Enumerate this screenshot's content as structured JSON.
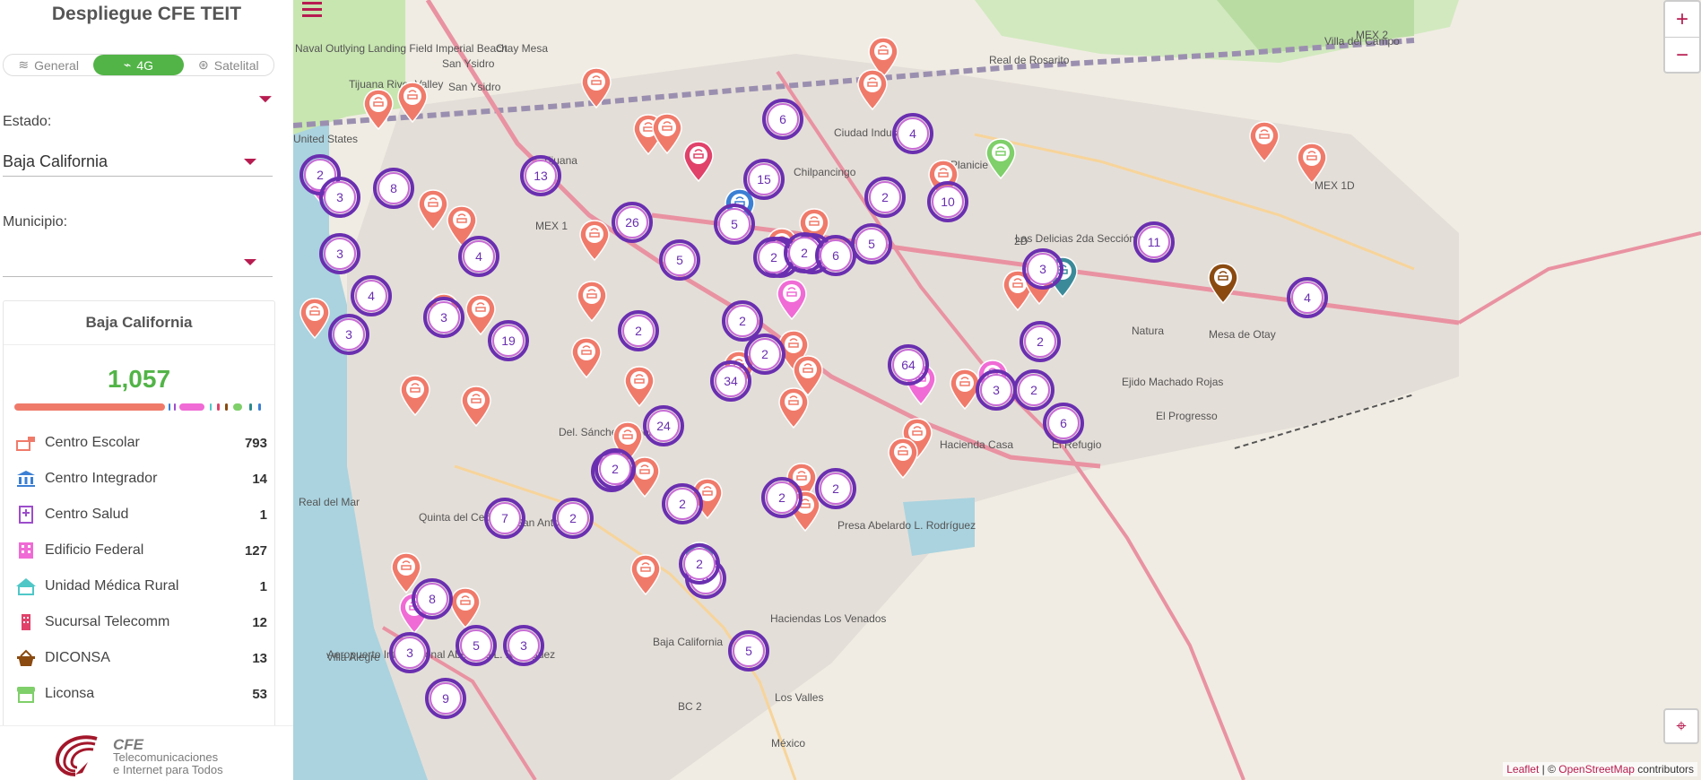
{
  "app": {
    "title": "Despliegue CFE TEIT"
  },
  "network_toggle": {
    "options": [
      {
        "label": "General",
        "icon": "layers-icon"
      },
      {
        "label": "4G",
        "icon": "wifi-router-icon"
      },
      {
        "label": "Satelital",
        "icon": "satellite-icon"
      }
    ],
    "selected": "4G"
  },
  "filters": {
    "clear_icon": "filter-clear-icon",
    "estado": {
      "label": "Estado:",
      "value": "Baja California"
    },
    "municipio": {
      "label": "Municipio:",
      "value": ""
    }
  },
  "summary": {
    "title": "Baja California",
    "total": "1,057",
    "categories": [
      {
        "label": "Centro Escolar",
        "count": "793",
        "color": "#f07a6a"
      },
      {
        "label": "Centro Integrador",
        "count": "14",
        "color": "#3a7fd4"
      },
      {
        "label": "Centro Salud",
        "count": "1",
        "color": "#9c4dcc"
      },
      {
        "label": "Edificio Federal",
        "count": "127",
        "color": "#f06bd5"
      },
      {
        "label": "Unidad Médica Rural",
        "count": "1",
        "color": "#4fc7c7"
      },
      {
        "label": "Sucursal Telecomm",
        "count": "12",
        "color": "#e0426a"
      },
      {
        "label": "DICONSA",
        "count": "13",
        "color": "#8a4a10"
      },
      {
        "label": "Liconsa",
        "count": "53",
        "color": "#7fcf6a"
      }
    ]
  },
  "footer": {
    "brand": "CFE",
    "line1": "Telecomunicaciones",
    "line2": "e Internet para Todos"
  },
  "map": {
    "zoom_in": "+",
    "zoom_out": "−",
    "place_labels": [
      "Otay Mesa",
      "San Ysidro",
      "San Ysidro",
      "Tijuana River Valley",
      "Naval Outlying Landing Field Imperial Beach",
      "United States",
      "Tijuana",
      "MEX 1",
      "Chilpancingo",
      "Ciudad Industrial",
      "Planicie",
      "Real del Mar",
      "Quinta del Cedro",
      "San Antonio",
      "Del. Sánchez Taboada",
      "Haciendas Los Venados",
      "Presa Abelardo L. Rodríguez",
      "Hacienda Casa",
      "El Refugio",
      "Ejido Machado Rojas",
      "El Progresso",
      "Villa del Campo",
      "Real de Rosarito",
      "Las Delicias 2da Sección",
      "Natura",
      "Villa Alegre",
      "Los Valles",
      "México",
      "Baja California",
      "BC 2",
      "MEX 2",
      "2D",
      "MEX 1D",
      "Mesa de Otay",
      "Aeropuerto Internacional Abelardo L. Rodríguez"
    ],
    "clusters": [
      "2",
      "3",
      "8",
      "13",
      "26",
      "5",
      "6",
      "15",
      "2",
      "4",
      "10",
      "3",
      "4",
      "3",
      "3",
      "4",
      "19",
      "3",
      "2",
      "2",
      "6",
      "5",
      "2",
      "3",
      "2",
      "3",
      "2",
      "64",
      "2",
      "2",
      "34",
      "5",
      "24",
      "2",
      "2",
      "6",
      "11",
      "2",
      "3",
      "4",
      "7",
      "2",
      "2",
      "2",
      "2",
      "4",
      "2",
      "2",
      "8",
      "3",
      "5",
      "5",
      "9",
      "3"
    ],
    "attribution_leaflet": "Leaflet",
    "attribution_osm": "OpenStreetMap",
    "attribution_suffix": " contributors",
    "attribution_sep": " | © "
  }
}
